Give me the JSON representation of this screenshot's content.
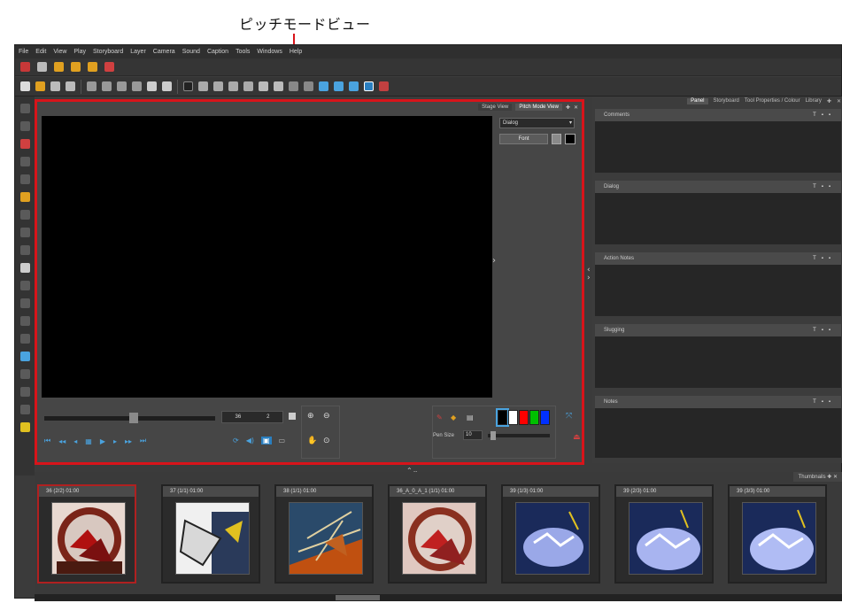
{
  "callout": {
    "label": "ピッチモードビュー"
  },
  "menu": [
    "File",
    "Edit",
    "View",
    "Play",
    "Storyboard",
    "Layer",
    "Camera",
    "Sound",
    "Caption",
    "Tools",
    "Windows",
    "Help"
  ],
  "pitch_view": {
    "tabs": [
      "Stage View",
      "Pitch Mode View"
    ],
    "active_tab": "Pitch Mode View",
    "dialog_select": "Dialog",
    "font_button": "Font",
    "frame_current": "36",
    "frame_total": "2",
    "pen_size_label": "Pen Size",
    "pen_size_value": "10",
    "swatch_colors": [
      "#ffffff",
      "#ff0000",
      "#00c000",
      "#0030ff"
    ]
  },
  "right_panel": {
    "tabs": [
      "Panel",
      "Storyboard",
      "Tool Properties / Colour",
      "Library"
    ],
    "active_tab": "Panel",
    "sections": [
      "Comments",
      "Dialog",
      "Action Notes",
      "Slugging",
      "Notes"
    ]
  },
  "thumbnails": {
    "header": "Thumbnails",
    "items": [
      "36 (2/2) 01:00",
      "37 (1/1) 01:00",
      "38 (1/1) 01:00",
      "36_A_0_A_1 (1/1) 01:00",
      "39 (1/3) 01:00",
      "39 (2/3) 01:00",
      "39 (3/3) 01:00"
    ]
  },
  "colors": {
    "highlight": "#d8141a",
    "accent": "#4aa3df"
  }
}
